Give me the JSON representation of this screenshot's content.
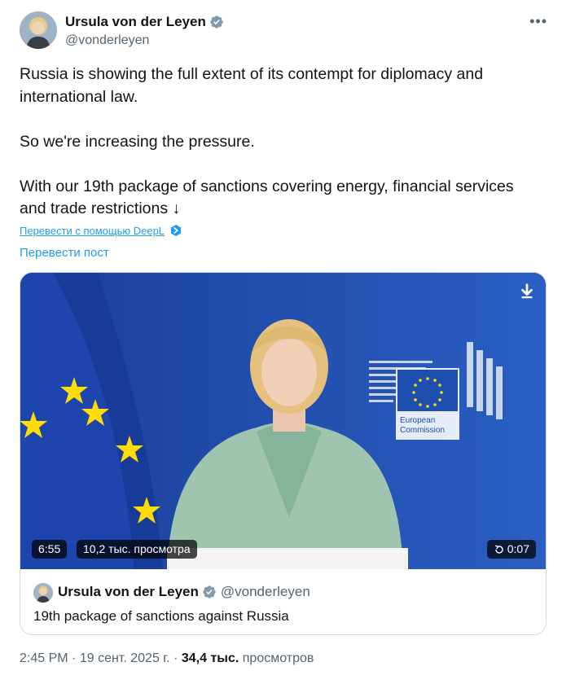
{
  "author": {
    "name": "Ursula von der Leyen",
    "handle": "@vonderleyen",
    "verified_icon": "verified-badge-icon"
  },
  "more_icon": "more-icon",
  "tweet": {
    "paragraph_1": "Russia is showing the full extent of its contempt for diplomacy and international law.",
    "paragraph_2": "So we're increasing the pressure.",
    "paragraph_3": "With our 19th package of sanctions covering energy, financial services and trade restrictions ↓"
  },
  "translate": {
    "deepl_label": "Перевести с помощью DeepL",
    "post_label": "Перевести пост"
  },
  "video": {
    "duration": "6:55",
    "views": "10,2 тыс. просмотра",
    "remaining": "0:07",
    "background_text_1": "European",
    "background_text_2": "Commission"
  },
  "quote": {
    "name": "Ursula von der Leyen",
    "handle": "@vonderleyen",
    "text": "19th package of sanctions against Russia"
  },
  "footer": {
    "time": "2:45 PM",
    "date": "19 сент. 2025 г.",
    "views_count": "34,4 тыс.",
    "views_label": "просмотров"
  },
  "colors": {
    "accent": "#1d9bf0",
    "text": "#0f1419",
    "secondary": "#536471",
    "eu_blue": "#1f4fb1",
    "eu_gold": "#ffdd00"
  }
}
